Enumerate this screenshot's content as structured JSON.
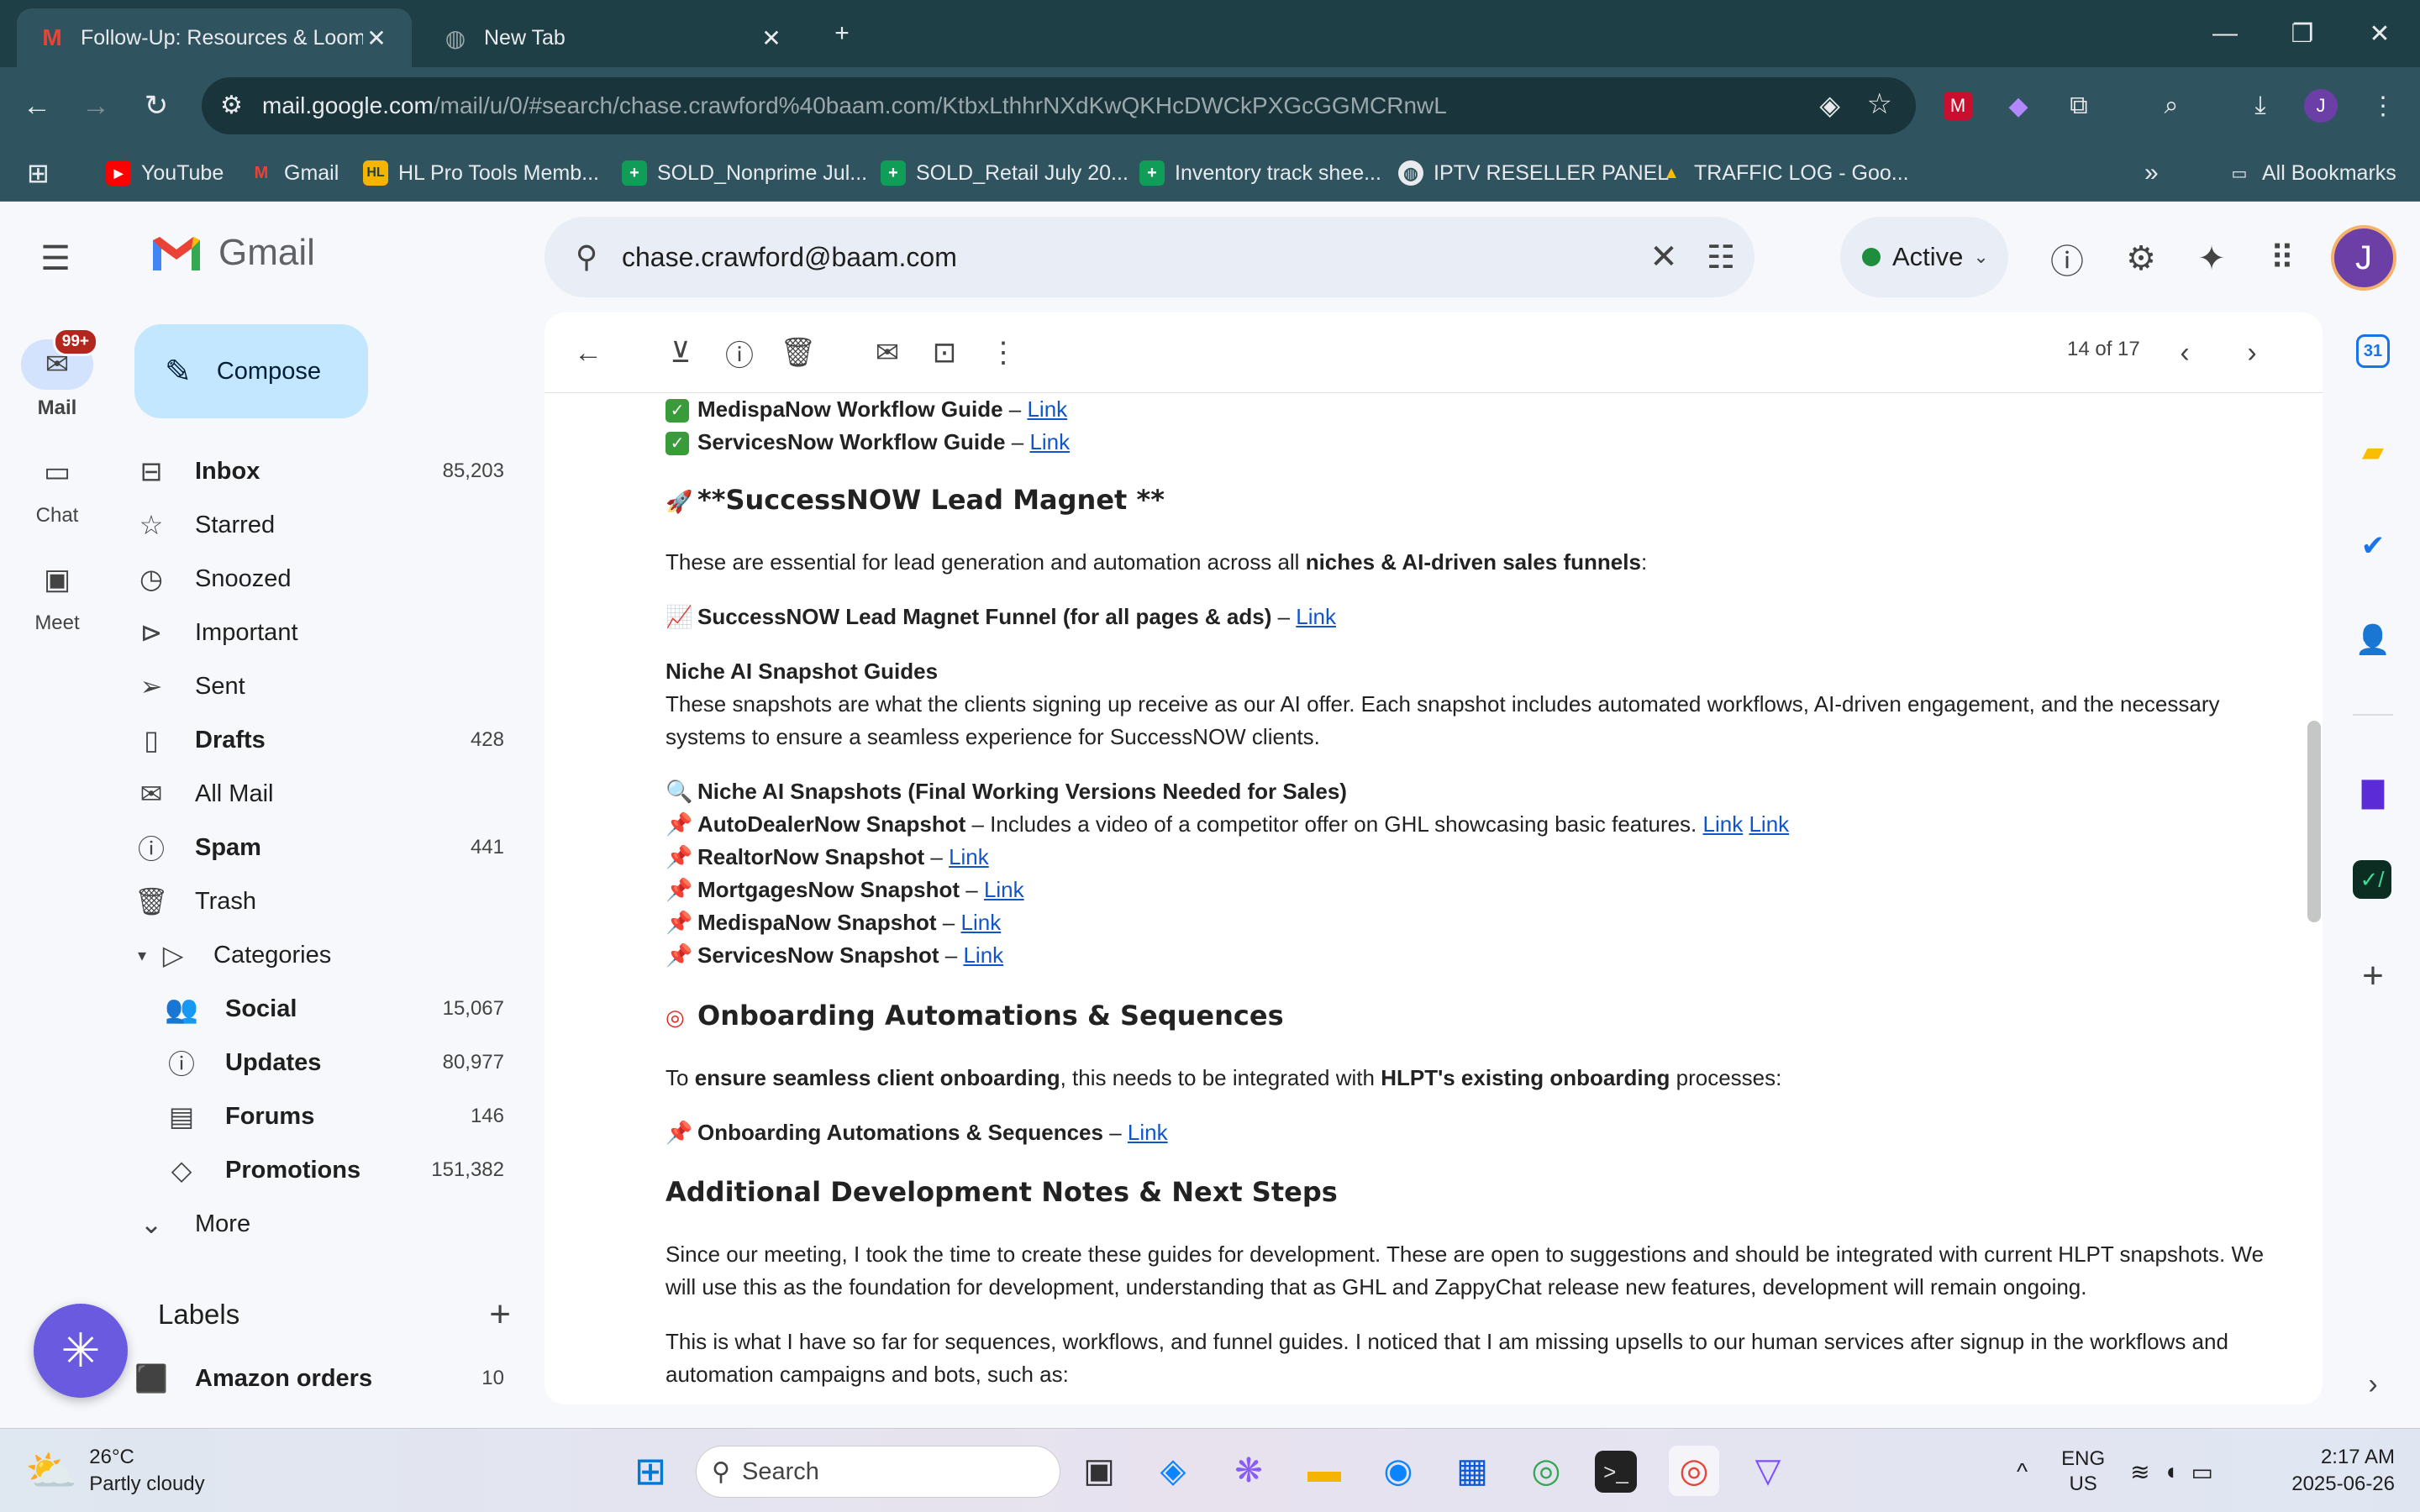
{
  "browser": {
    "tabs": [
      {
        "title": "Follow-Up: Resources & Loom V",
        "icon": "gmail-icon"
      },
      {
        "title": "New Tab",
        "icon": "globe-icon"
      }
    ],
    "url_host": "mail.google.com",
    "url_path": "/mail/u/0/#search/chase.crawford%40baam.com/KtbxLthhrNXdKwQKHcDWCkPXGcGGMCRnwL",
    "bookmarks": [
      {
        "label": "YouTube",
        "icon": "youtube-icon",
        "color": "#ff0000"
      },
      {
        "label": "Gmail",
        "icon": "gmail-icon",
        "color": "#ea4335"
      },
      {
        "label": "HL Pro Tools Memb...",
        "icon": "hl-icon",
        "color": "#f4b400"
      },
      {
        "label": "SOLD_Nonprime Jul...",
        "icon": "sheets-icon",
        "color": "#0f9d58"
      },
      {
        "label": "SOLD_Retail July 20...",
        "icon": "sheets-icon",
        "color": "#0f9d58"
      },
      {
        "label": "Inventory track shee...",
        "icon": "sheets-icon",
        "color": "#0f9d58"
      },
      {
        "label": "IPTV RESELLER PANEL",
        "icon": "globe-icon",
        "color": "#5f6368"
      },
      {
        "label": "TRAFFIC LOG - Goo...",
        "icon": "drive-icon",
        "color": "#fbbc04"
      }
    ],
    "all_bookmarks": "All Bookmarks"
  },
  "gmail": {
    "brand": "Gmail",
    "search_value": "chase.crawford@baam.com",
    "status": "Active",
    "avatar_letter": "J",
    "rail": [
      {
        "label": "Mail",
        "badge": "99+"
      },
      {
        "label": "Chat"
      },
      {
        "label": "Meet"
      }
    ],
    "compose": "Compose",
    "nav": [
      {
        "label": "Inbox",
        "count": "85,203",
        "bold": true
      },
      {
        "label": "Starred",
        "count": ""
      },
      {
        "label": "Snoozed",
        "count": ""
      },
      {
        "label": "Important",
        "count": ""
      },
      {
        "label": "Sent",
        "count": ""
      },
      {
        "label": "Drafts",
        "count": "428",
        "bold": true
      },
      {
        "label": "All Mail",
        "count": ""
      },
      {
        "label": "Spam",
        "count": "441",
        "bold": true
      },
      {
        "label": "Trash",
        "count": ""
      },
      {
        "label": "Categories",
        "count": ""
      },
      {
        "label": "Social",
        "count": "15,067",
        "bold": true
      },
      {
        "label": "Updates",
        "count": "80,977",
        "bold": true
      },
      {
        "label": "Forums",
        "count": "146",
        "bold": true
      },
      {
        "label": "Promotions",
        "count": "151,382",
        "bold": true
      },
      {
        "label": "More",
        "count": ""
      }
    ],
    "labels_title": "Labels",
    "labels": [
      {
        "label": "Amazon orders",
        "count": "10"
      }
    ],
    "pager": "14 of 17"
  },
  "email": {
    "l1_title": "MedispaNow Workflow Guide",
    "l2_title": "ServicesNow Workflow Guide",
    "link": "Link",
    "dash": " – ",
    "h_lead_magnet": "**SuccessNOW Lead Magnet **",
    "p_essential_a": "These are essential for lead generation and automation across all ",
    "p_essential_b": "niches & AI-driven sales funnels",
    "p_essential_c": ":",
    "funnel_title": "SuccessNOW Lead Magnet Funnel (for all pages & ads)",
    "niche_head": "Niche AI Snapshot Guides",
    "niche_p1": "These snapshots are what the clients signing up receive as our AI offer. Each snapshot includes automated workflows, AI-driven engagement, and the necessary",
    "niche_p2": "systems to ensure a seamless experience for SuccessNOW clients.",
    "snap_head": "Niche AI Snapshots (Final Working Versions Needed for Sales)",
    "auto_title": "AutoDealerNow Snapshot",
    "auto_desc": " – Includes a video of a competitor offer on GHL showcasing basic features. ",
    "realtor_title": "RealtorNow Snapshot",
    "mortgage_title": "MortgagesNow Snapshot",
    "medispa_title": "MedispaNow Snapshot",
    "services_title": "ServicesNow Snapshot",
    "h_onboarding": "Onboarding Automations & Sequences",
    "ob_a": "To ",
    "ob_b": "ensure seamless client onboarding",
    "ob_c": ", this needs to be integrated with ",
    "ob_d": "HLPT's existing onboarding",
    "ob_e": " processes:",
    "ob_item": "Onboarding Automations & Sequences",
    "h_additional": "Additional Development Notes & Next Steps",
    "dev_p1": "Since our meeting, I took the time to create these guides for development. These are open to suggestions and should be integrated with current HLPT snapshots. We",
    "dev_p2": "will use this as the foundation for development, understanding that as GHL and ZappyChat release new features, development will remain ongoing.",
    "dev_p3": "This is what I have so far for sequences, workflows, and funnel guides. I noticed that I am missing upsells to our human services after signup in the workflows and",
    "dev_p4": "automation campaigns and bots, such as:"
  },
  "taskbar": {
    "temp": "26°C",
    "weather": "Partly cloudy",
    "search": "Search",
    "lang1": "ENG",
    "lang2": "US",
    "time": "2:17 AM",
    "date": "2025-06-26"
  }
}
